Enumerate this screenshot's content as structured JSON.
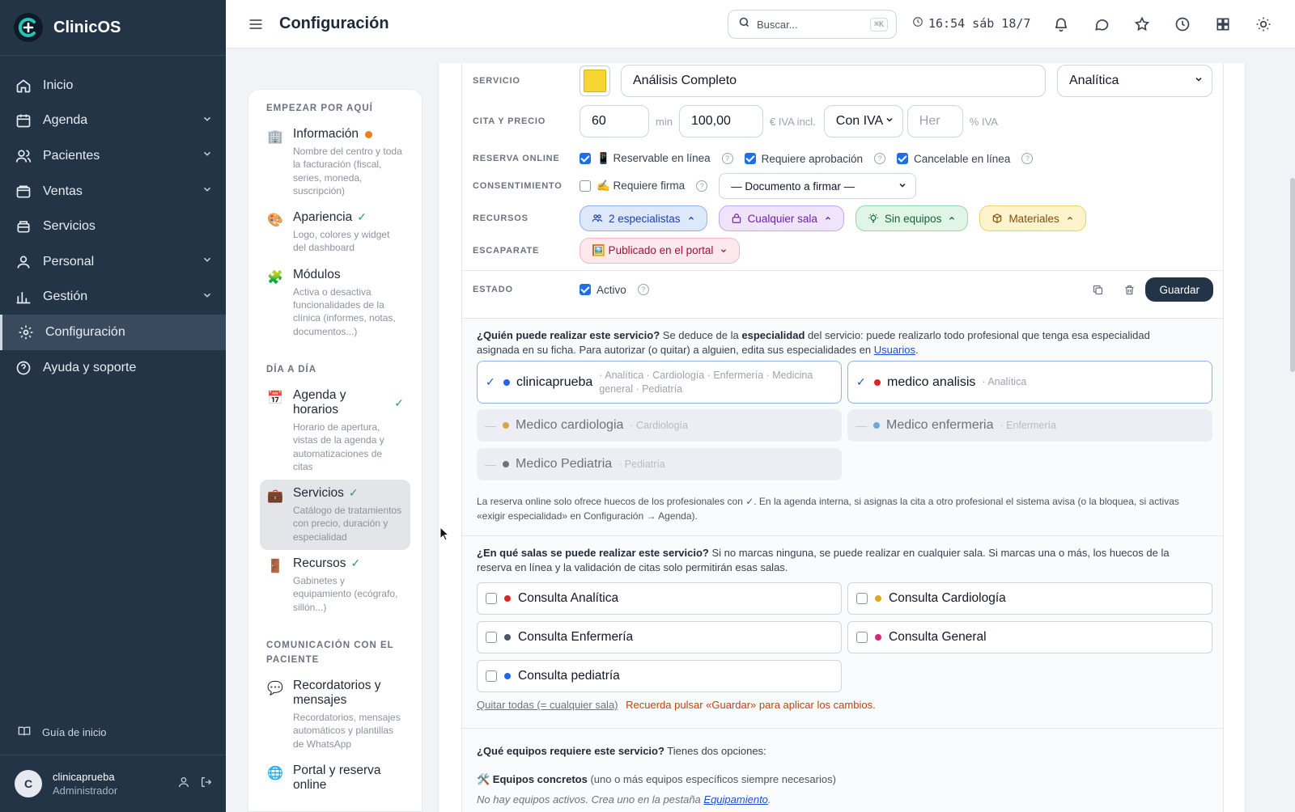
{
  "app": {
    "name": "ClinicOS"
  },
  "sidebar": {
    "items": [
      {
        "label": "Inicio",
        "icon": "home-icon"
      },
      {
        "label": "Agenda",
        "icon": "calendar-icon"
      },
      {
        "label": "Pacientes",
        "icon": "users-icon"
      },
      {
        "label": "Ventas",
        "icon": "wallet-icon"
      },
      {
        "label": "Servicios",
        "icon": "box-icon"
      },
      {
        "label": "Personal",
        "icon": "user-badge-icon"
      },
      {
        "label": "Gestión",
        "icon": "bar-chart-icon"
      },
      {
        "label": "Configuración",
        "icon": "gear-icon"
      },
      {
        "label": "Ayuda y soporte",
        "icon": "help-icon"
      }
    ],
    "guide": "Guía de inicio",
    "user": {
      "initial": "C",
      "name": "clinicaprueba",
      "role": "Administrador"
    }
  },
  "topbar": {
    "title": "Configuración",
    "search_placeholder": "Buscar...",
    "search_shortcut": "⌘K",
    "clock": "16:54 sáb 18/7"
  },
  "config_nav": {
    "sections": [
      {
        "title": "Empezar por aquí"
      },
      {
        "title": "Día a día"
      },
      {
        "title": "Comunicación con el paciente"
      }
    ],
    "items": [
      {
        "title": "Información",
        "desc": "Nombre del centro y toda la facturación (fiscal, series, moneda, suscripción)",
        "emoji": "🏢"
      },
      {
        "title": "Apariencia",
        "desc": "Logo, colores y widget del dashboard",
        "emoji": "🎨"
      },
      {
        "title": "Módulos",
        "desc": "Activa o desactiva funcionalidades de la clínica (informes, notas, documentos...)",
        "emoji": "🧩"
      },
      {
        "title": "Agenda y horarios",
        "desc": "Horario de apertura, vistas de la agenda y automatizaciones de citas",
        "emoji": "📅"
      },
      {
        "title": "Servicios",
        "desc": "Catálogo de tratamientos con precio, duración y especialidad",
        "emoji": "💼"
      },
      {
        "title": "Recursos",
        "desc": "Gabinetes y equipamiento (ecógrafo, sillón...)",
        "emoji": "🚪"
      },
      {
        "title": "Recordatorios y mensajes",
        "desc": "Recordatorios, mensajes automáticos y plantillas de WhatsApp",
        "emoji": "💬"
      },
      {
        "title": "Portal y reserva online",
        "desc": "",
        "emoji": "🌐"
      }
    ]
  },
  "form": {
    "labels": {
      "servicio": "Servicio",
      "cita_precio": "Cita y precio",
      "reserva": "Reserva online",
      "consentimiento": "Consentimiento",
      "recursos": "Recursos",
      "escaparate": "Escaparate",
      "estado": "Estado"
    },
    "service_color": "#f7d631",
    "service_name": "Análisis Completo",
    "category": "Analítica",
    "duration": "60",
    "duration_unit": "min",
    "price": "100,00",
    "price_unit": "€ IVA incl.",
    "tax_mode": "Con IVA",
    "tax_placeholder": "Her",
    "tax_unit": "% IVA",
    "reservable": "📱 Reservable en línea",
    "approval": "Requiere aprobación",
    "cancelable": "Cancelable en línea",
    "signature": "✍️ Requiere firma",
    "document": "— Documento a firmar —",
    "resources": {
      "specialists": "2 especialistas",
      "room": "Cualquier sala",
      "equipment": "Sin equipos",
      "materials": "Materiales"
    },
    "showcase": "🖼️ Publicado en el portal",
    "active": "Activo",
    "save": "Guardar"
  },
  "who": {
    "q": "¿Quién puede realizar este servicio?",
    "t1": " Se deduce de la ",
    "b": "especialidad",
    "t2": " del servicio: puede realizarlo todo profesional que tenga esa especialidad asignada en su ficha. Para autorizar (o quitar) a alguien, edita sus especialidades en ",
    "link": "Usuarios",
    "t3": ".",
    "pros": [
      {
        "name": "clinicaprueba",
        "spec": "· Analítica · Cardiología · Enfermería · Medicina general · Pediatría",
        "color": "#2563eb",
        "on": true
      },
      {
        "name": "medico analisis",
        "spec": "· Analítica",
        "color": "#dc2626",
        "on": true
      },
      {
        "name": "Medico cardiologia",
        "spec": "· Cardiología",
        "color": "#d4a64a",
        "on": false
      },
      {
        "name": "Medico enfermeria",
        "spec": "· Enfermería",
        "color": "#6aa8d8",
        "on": false
      },
      {
        "name": "Medico Pediatria",
        "spec": "· Pediatría",
        "color": "#6b7280",
        "on": false
      }
    ],
    "note": "La reserva online solo ofrece huecos de los profesionales con ✓. En la agenda interna, si asignas la cita a otro profesional el sistema avisa (o la bloquea, si activas «exigir especialidad» en Configuración → Agenda)."
  },
  "rooms": {
    "q": "¿En qué salas se puede realizar este servicio?",
    "t": " Si no marcas ninguna, se puede realizar en cualquier sala. Si marcas una o más, los huecos de la reserva en línea y la validación de citas solo permitirán esas salas.",
    "list": [
      {
        "name": "Consulta Analítica",
        "color": "#dc2626"
      },
      {
        "name": "Consulta Cardiología",
        "color": "#e0a81c"
      },
      {
        "name": "Consulta Enfermería",
        "color": "#4b5563"
      },
      {
        "name": "Consulta General",
        "color": "#db2777"
      },
      {
        "name": "Consulta pediatría",
        "color": "#2563eb"
      }
    ],
    "clear": "Quitar todas (= cualquier sala)",
    "reminder": "Recuerda pulsar «Guardar» para aplicar los cambios."
  },
  "equip": {
    "q": "¿Qué equipos requiere este servicio?",
    "t": " Tienes dos opciones:",
    "opt1_b": "🛠️ Equipos concretos",
    "opt1_t": " (uno o más equipos específicos siempre necesarios)",
    "empty": "No hay equipos activos. Crea uno en la pestaña ",
    "empty_link": "Equipamiento",
    "empty_end": "."
  }
}
